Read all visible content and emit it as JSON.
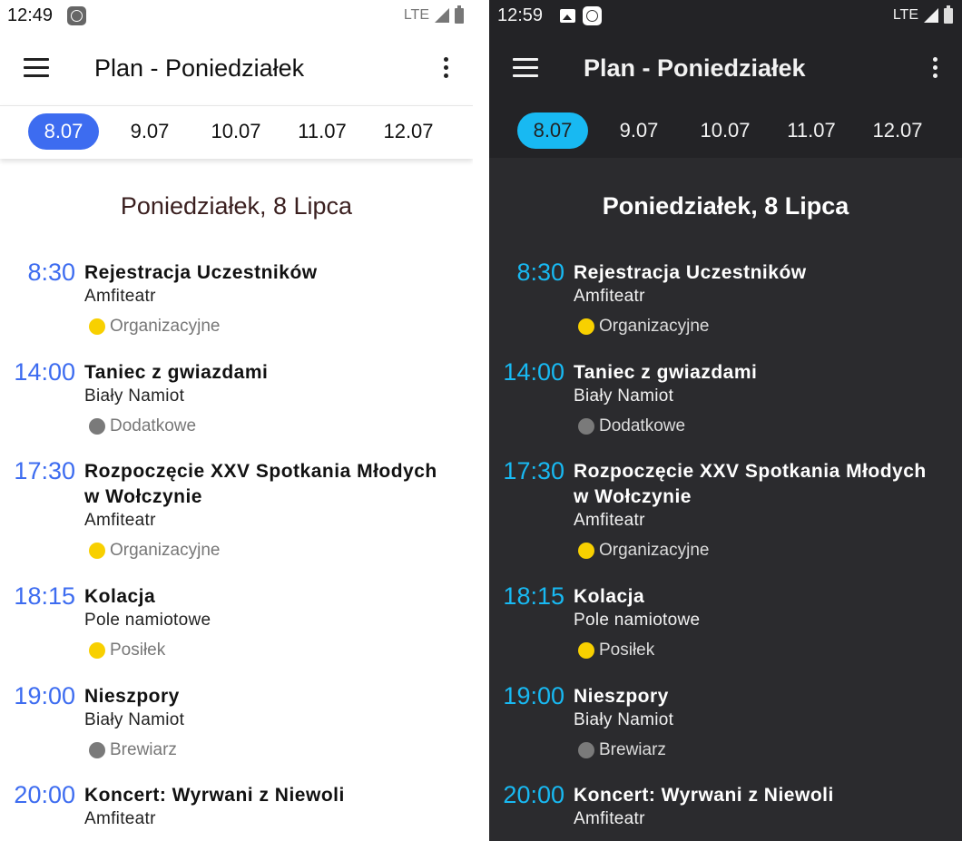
{
  "screens": [
    {
      "theme": "light",
      "status_time": "12:49",
      "network": "LTE",
      "title": "Plan - Poniedziałek",
      "tabs": [
        "8.07",
        "9.07",
        "10.07",
        "11.07",
        "12.07"
      ],
      "active_tab": "8.07",
      "day_heading": "Poniedziałek, 8 Lipca",
      "accent_color": "#3d6cf0"
    },
    {
      "theme": "dark",
      "status_time": "12:59",
      "network": "LTE",
      "title": "Plan - Poniedziałek",
      "tabs": [
        "8.07",
        "9.07",
        "10.07",
        "11.07",
        "12.07"
      ],
      "active_tab": "8.07",
      "day_heading": "Poniedziałek, 8 Lipca",
      "accent_color": "#18b9f2"
    }
  ],
  "events": [
    {
      "time": "8:30",
      "title": "Rejestracja Uczestników",
      "place": "Amfiteatr",
      "category": "Organizacyjne",
      "category_color": "#f8d000"
    },
    {
      "time": "14:00",
      "title": "Taniec z gwiazdami",
      "place": "Biały Namiot",
      "category": "Dodatkowe",
      "category_color": "#7a7a7a"
    },
    {
      "time": "17:30",
      "title": "Rozpoczęcie XXV Spotkania Młodych w Wołczynie",
      "place": "Amfiteatr",
      "category": "Organizacyjne",
      "category_color": "#f8d000"
    },
    {
      "time": "18:15",
      "title": "Kolacja",
      "place": "Pole namiotowe",
      "category": "Posiłek",
      "category_color": "#f8d000"
    },
    {
      "time": "19:00",
      "title": "Nieszpory",
      "place": "Biały Namiot",
      "category": "Brewiarz",
      "category_color": "#7a7a7a"
    },
    {
      "time": "20:00",
      "title": "Koncert: Wyrwani z Niewoli",
      "place": "Amfiteatr",
      "category": "",
      "category_color": ""
    }
  ],
  "icons": {
    "menu": "menu-icon",
    "more": "more-vert-icon",
    "notification": "app-notification-icon",
    "gallery": "image-icon",
    "signal": "signal-icon",
    "battery": "battery-icon"
  }
}
